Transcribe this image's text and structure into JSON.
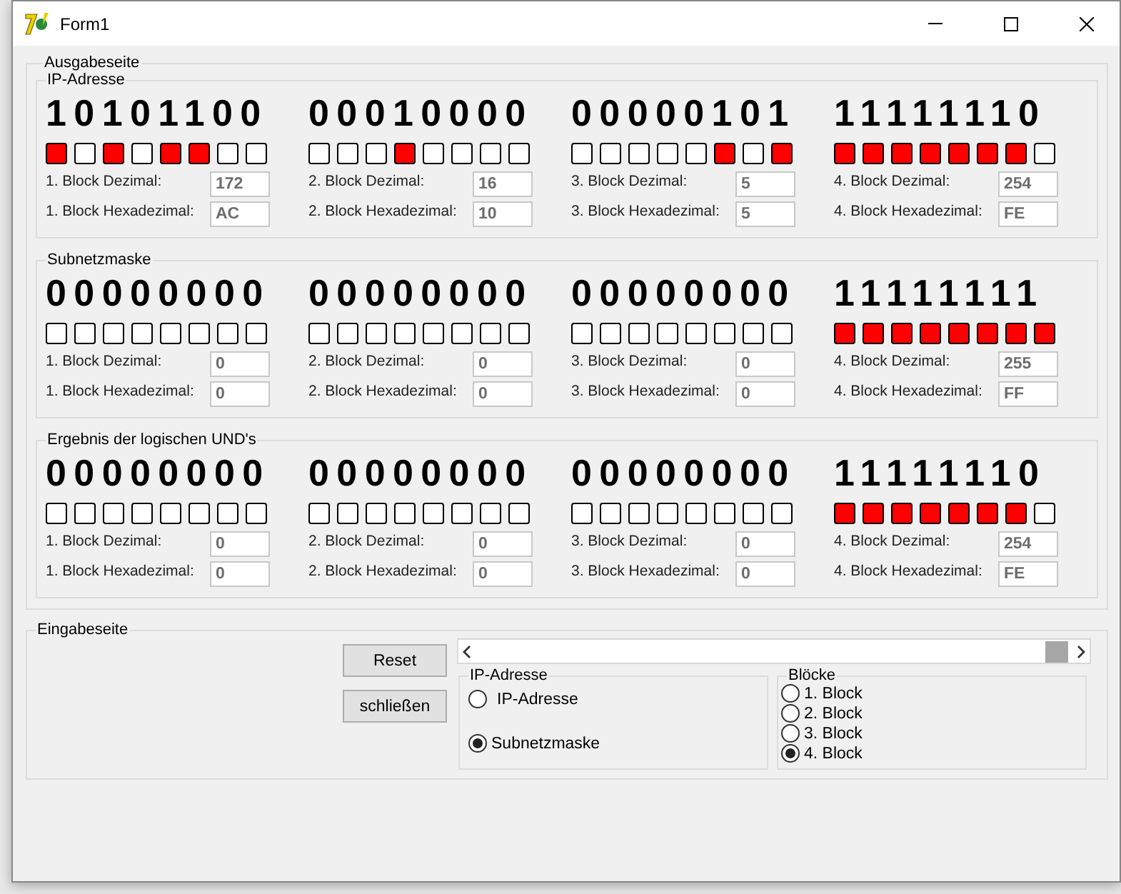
{
  "window": {
    "title": "Form1"
  },
  "output": {
    "legend": "Ausgabeseite",
    "groups": [
      {
        "legend": "IP-Adresse",
        "blocks": [
          {
            "bits": "10101100",
            "leds": [
              {
                "on": true
              },
              {
                "on": false
              },
              {
                "on": true
              },
              {
                "on": false
              },
              {
                "on": true
              },
              {
                "on": true
              },
              {
                "on": false
              },
              {
                "on": false
              }
            ],
            "dec_label": "1. Block Dezimal:",
            "dec_value": "172",
            "hex_label": "1. Block Hexadezimal:",
            "hex_value": "AC"
          },
          {
            "bits": "00010000",
            "leds": [
              {
                "on": false
              },
              {
                "on": false
              },
              {
                "on": false
              },
              {
                "on": true
              },
              {
                "on": false
              },
              {
                "on": false
              },
              {
                "on": false
              },
              {
                "on": false
              }
            ],
            "dec_label": "2. Block Dezimal:",
            "dec_value": "16",
            "hex_label": "2. Block Hexadezimal:",
            "hex_value": "10"
          },
          {
            "bits": "00000101",
            "leds": [
              {
                "on": false
              },
              {
                "on": false
              },
              {
                "on": false
              },
              {
                "on": false
              },
              {
                "on": false
              },
              {
                "on": true
              },
              {
                "on": false
              },
              {
                "on": true
              }
            ],
            "dec_label": "3. Block Dezimal:",
            "dec_value": "5",
            "hex_label": "3. Block Hexadezimal:",
            "hex_value": "5"
          },
          {
            "bits": "11111110",
            "leds": [
              {
                "on": true
              },
              {
                "on": true
              },
              {
                "on": true
              },
              {
                "on": true
              },
              {
                "on": true
              },
              {
                "on": true
              },
              {
                "on": true
              },
              {
                "on": false
              }
            ],
            "dec_label": "4. Block Dezimal:",
            "dec_value": "254",
            "hex_label": "4. Block Hexadezimal:",
            "hex_value": "FE"
          }
        ]
      },
      {
        "legend": "Subnetzmaske",
        "blocks": [
          {
            "bits": "00000000",
            "leds": [
              {
                "on": false
              },
              {
                "on": false
              },
              {
                "on": false
              },
              {
                "on": false
              },
              {
                "on": false
              },
              {
                "on": false
              },
              {
                "on": false
              },
              {
                "on": false
              }
            ],
            "dec_label": "1. Block Dezimal:",
            "dec_value": "0",
            "hex_label": "1. Block Hexadezimal:",
            "hex_value": "0"
          },
          {
            "bits": "00000000",
            "leds": [
              {
                "on": false
              },
              {
                "on": false
              },
              {
                "on": false
              },
              {
                "on": false
              },
              {
                "on": false
              },
              {
                "on": false
              },
              {
                "on": false
              },
              {
                "on": false
              }
            ],
            "dec_label": "2. Block Dezimal:",
            "dec_value": "0",
            "hex_label": "2. Block Hexadezimal:",
            "hex_value": "0"
          },
          {
            "bits": "00000000",
            "leds": [
              {
                "on": false
              },
              {
                "on": false
              },
              {
                "on": false
              },
              {
                "on": false
              },
              {
                "on": false
              },
              {
                "on": false
              },
              {
                "on": false
              },
              {
                "on": false
              }
            ],
            "dec_label": "3. Block Dezimal:",
            "dec_value": "0",
            "hex_label": "3. Block Hexadezimal:",
            "hex_value": "0"
          },
          {
            "bits": "11111111",
            "leds": [
              {
                "on": true
              },
              {
                "on": true
              },
              {
                "on": true
              },
              {
                "on": true
              },
              {
                "on": true
              },
              {
                "on": true
              },
              {
                "on": true
              },
              {
                "on": true
              }
            ],
            "dec_label": "4. Block Dezimal:",
            "dec_value": "255",
            "hex_label": "4. Block Hexadezimal:",
            "hex_value": "FF"
          }
        ]
      },
      {
        "legend": "Ergebnis der logischen UND's",
        "blocks": [
          {
            "bits": "00000000",
            "leds": [
              {
                "on": false
              },
              {
                "on": false
              },
              {
                "on": false
              },
              {
                "on": false
              },
              {
                "on": false
              },
              {
                "on": false
              },
              {
                "on": false
              },
              {
                "on": false
              }
            ],
            "dec_label": "1. Block Dezimal:",
            "dec_value": "0",
            "hex_label": "1. Block Hexadezimal:",
            "hex_value": "0"
          },
          {
            "bits": "00000000",
            "leds": [
              {
                "on": false
              },
              {
                "on": false
              },
              {
                "on": false
              },
              {
                "on": false
              },
              {
                "on": false
              },
              {
                "on": false
              },
              {
                "on": false
              },
              {
                "on": false
              }
            ],
            "dec_label": "2. Block Dezimal:",
            "dec_value": "0",
            "hex_label": "2. Block Hexadezimal:",
            "hex_value": "0"
          },
          {
            "bits": "00000000",
            "leds": [
              {
                "on": false
              },
              {
                "on": false
              },
              {
                "on": false
              },
              {
                "on": false
              },
              {
                "on": false
              },
              {
                "on": false
              },
              {
                "on": false
              },
              {
                "on": false
              }
            ],
            "dec_label": "3. Block Dezimal:",
            "dec_value": "0",
            "hex_label": "3. Block Hexadezimal:",
            "hex_value": "0"
          },
          {
            "bits": "11111110",
            "leds": [
              {
                "on": true
              },
              {
                "on": true
              },
              {
                "on": true
              },
              {
                "on": true
              },
              {
                "on": true
              },
              {
                "on": true
              },
              {
                "on": true
              },
              {
                "on": false
              }
            ],
            "dec_label": "4. Block Dezimal:",
            "dec_value": "254",
            "hex_label": "4. Block Hexadezimal:",
            "hex_value": "FE"
          }
        ]
      }
    ]
  },
  "input": {
    "legend": "Eingabeseite",
    "buttons": [
      "Reset",
      "schließen"
    ],
    "address_group": {
      "legend": "IP-Adresse",
      "options": [
        {
          "label": "IP-Adresse",
          "selected": false
        },
        {
          "label": "Subnetzmaske",
          "selected": true
        }
      ]
    },
    "block_group": {
      "legend": "Blöcke",
      "options": [
        {
          "label": "1. Block",
          "selected": false
        },
        {
          "label": "2. Block",
          "selected": false
        },
        {
          "label": "3. Block",
          "selected": false
        },
        {
          "label": "4. Block",
          "selected": true
        }
      ]
    }
  }
}
